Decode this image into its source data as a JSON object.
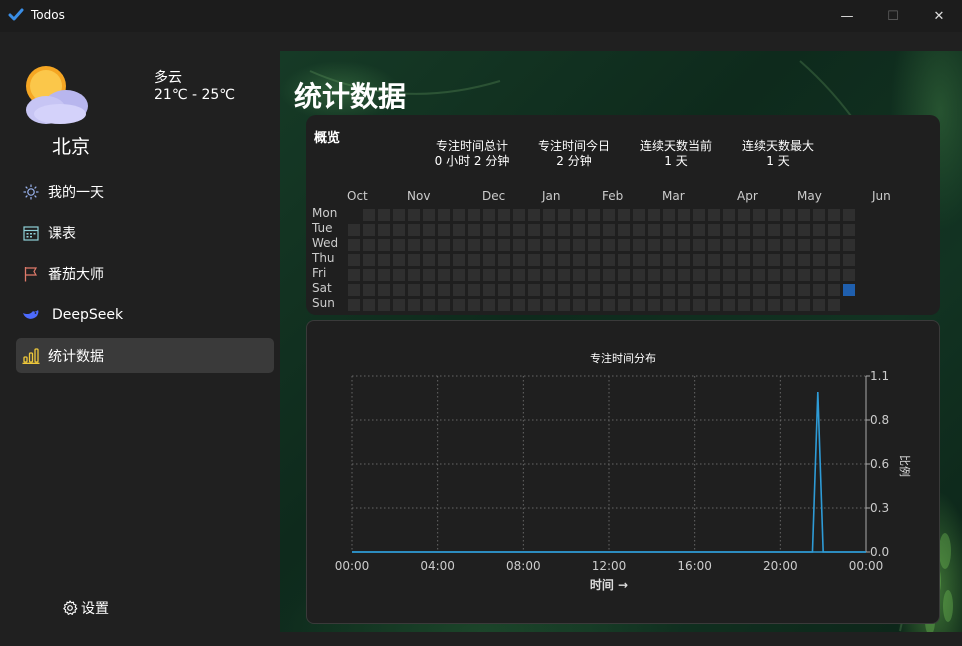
{
  "window": {
    "title": "Todos",
    "minimize": "—",
    "maximize": "☐",
    "close": "✕"
  },
  "weather": {
    "condition": "多云",
    "temp": "21℃ - 25℃",
    "city": "北京"
  },
  "nav": [
    {
      "label": "我的一天",
      "icon": "sun-icon"
    },
    {
      "label": "课表",
      "icon": "calendar-icon"
    },
    {
      "label": "番茄大师",
      "icon": "flag-icon"
    },
    {
      "label": "DeepSeek",
      "icon": "whale-icon"
    },
    {
      "label": "统计数据",
      "icon": "bar-chart-icon",
      "active": true
    }
  ],
  "settings": {
    "label": "设置"
  },
  "page": {
    "title": "统计数据"
  },
  "overview": {
    "title": "概览",
    "stats": [
      {
        "label": "专注时间总计",
        "value": "0 小时 2 分钟"
      },
      {
        "label": "专注时间今日",
        "value": "2 分钟"
      },
      {
        "label": "连续天数当前",
        "value": "1 天"
      },
      {
        "label": "连续天数最大",
        "value": "1 天"
      }
    ],
    "months": [
      "Oct",
      "Nov",
      "Dec",
      "Jan",
      "Feb",
      "Mar",
      "Apr",
      "May",
      "Jun"
    ],
    "days": [
      "Mon",
      "Tue",
      "Wed",
      "Thu",
      "Fri",
      "Sat",
      "Sun"
    ],
    "heatmap": {
      "weeks": 34,
      "active_week": 33,
      "active_day": "Sat",
      "active_color": "#1f5fae",
      "empty_color": "#2f2f2f"
    }
  },
  "chart_data": {
    "type": "line",
    "title": "专注时间分布",
    "xlabel": "时间 →",
    "ylabel": "比例",
    "x_ticks": [
      "00:00",
      "04:00",
      "08:00",
      "12:00",
      "16:00",
      "20:00",
      "00:00"
    ],
    "y_ticks": [
      "0.0",
      "0.3",
      "0.6",
      "0.8",
      "1.1"
    ],
    "ylim": [
      0,
      1.1
    ],
    "xlim_hours": [
      0,
      24
    ],
    "grid": true,
    "color": "#2e9bd6",
    "series": [
      {
        "x": [
          0,
          21.5,
          21.75,
          22.0,
          24
        ],
        "y": [
          0,
          0,
          1.0,
          0,
          0
        ]
      }
    ]
  }
}
